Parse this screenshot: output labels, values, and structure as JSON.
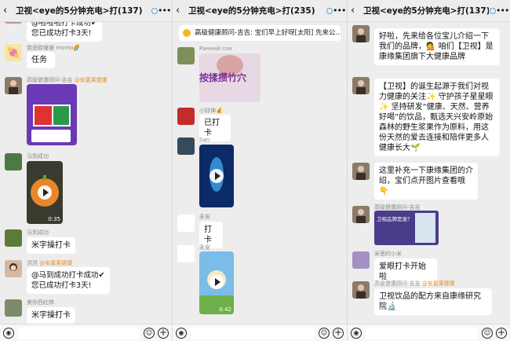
{
  "panel1": {
    "header": {
      "title": "卫视<eye的5分钟充电>打",
      "count": "(137)"
    },
    "top_bubble_line1": "@啦啦啦打卡成功✔",
    "top_bubble_line2": "您已成功打卡3天!",
    "momo_nick": "我是欧锤锤 momo🌈",
    "momo_text": "任务",
    "jiji_nick": "高级健康顾问-吉吉",
    "jiji_org": "@安嘉莱健康",
    "mayu1_nick": "马到成功",
    "duration1": "0:35",
    "mayu2_nick": "马到成功",
    "mayu2_text": "米字操打卡",
    "hongyang_nick": "洪洪",
    "hongyang_org": "@安嘉莱健康",
    "hongyang_line1": "@马到成功打卡成功✔",
    "hongyang_line2": "您已成功打卡3天!",
    "meiyan_nick": "美你西红柿",
    "meiyan_text": "米字操打卡"
  },
  "panel2": {
    "header": {
      "title": "卫视<eye的5分钟充电>打",
      "count": "(235)"
    },
    "notice": "高级健康顾问-吉吉: 宝们早上好呀[太阳] 先来公...",
    "ransheng_nick": "Ранний сон",
    "video_title": "按揉攒竹穴",
    "xiaocai_nick": "小财神💰",
    "xiaocai_text": "已打卡",
    "san_nick": "San",
    "yongan1_nick": "永安",
    "yongan1_text": "打卡",
    "yongan2_nick": "永安",
    "duration2": "0:42"
  },
  "panel3": {
    "header": {
      "title": "卫视<eye的5分钟充电>打",
      "count": "(137)"
    },
    "msg1": "好啦，先来给各位宝儿介绍一下我们的品牌，💁 咱们【卫视】是康缘集团旗下大健康品牌",
    "msg2": "【卫视】的诞生起源于我们对视力健康的关注✨ 守护孩子星星眼✨ 坚持研发“健康、天然、营养好喝”的饮品，甄选天兴安岭原始森林的野生浆果作为原料，用这份天然的爱去连接和陪伴更多人健康长大🌱",
    "msg3": "这里补充一下康缘集团的介绍，宝们点开图片查看哦👇",
    "jiji_nick": "高级健康顾问-吉吉",
    "poster_title": "卫视品牌是谁？",
    "xiaomi_nick": "米思的小米",
    "xiaomi_text": "爱眼打卡开始啦",
    "jiji2_nick": "高级健康顾问-吉吉",
    "jiji2_org": "@安嘉莱健康",
    "msg4": "卫视饮品的配方来自康缘研究院🔬"
  }
}
